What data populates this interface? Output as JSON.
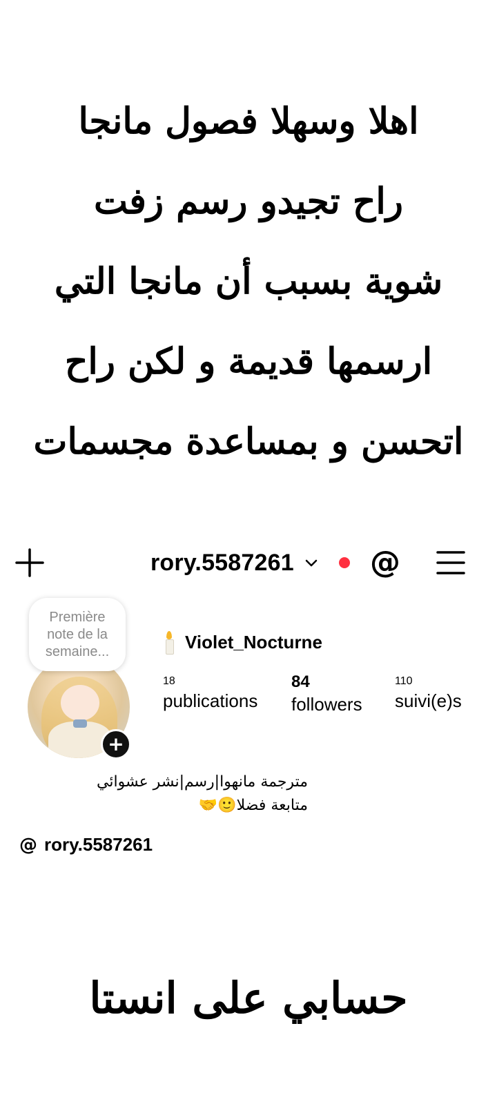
{
  "intro": {
    "lines": [
      "اهلا وسهلا فصول مانجا",
      "راح تجيدو رسم زفت",
      "شوية بسبب أن مانجا التي",
      "ارسمها قديمة و لكن راح",
      "اتحسن و بمساعدة مجسمات"
    ]
  },
  "topbar": {
    "username": "rory.5587261",
    "icons": {
      "create": "plus-icon",
      "switch": "chevron-down-icon",
      "threads": "threads-icon",
      "menu": "hamburger-menu-icon"
    },
    "threads_glyph": "@",
    "notification_color": "#ff3040"
  },
  "profile": {
    "note": "Première note de la semaine...",
    "display_name": "Violet_Nocturne",
    "name_icon": "candle-icon",
    "add_badge": "+",
    "stats": {
      "posts": {
        "value": "18",
        "label": "publications"
      },
      "followers": {
        "value": "84",
        "label": "followers"
      },
      "following": {
        "value": "110",
        "label": "suivi(e)s"
      }
    },
    "bio_lines": [
      "مترجمة مانهوا|رسم|نشر عشوائي",
      "متابعة فضلا🙂🤝"
    ],
    "threads_link": {
      "glyph": "@",
      "handle": "rory.5587261"
    }
  },
  "outro": {
    "text": "حسابي على انستا"
  }
}
